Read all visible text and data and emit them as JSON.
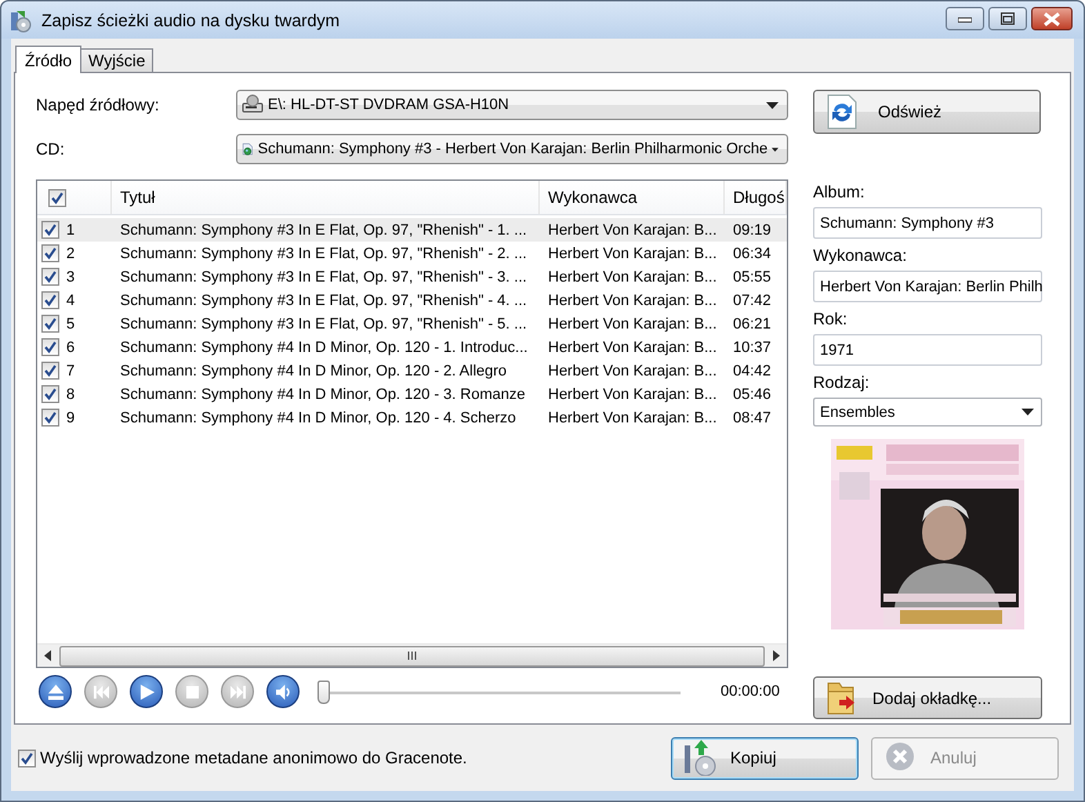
{
  "window": {
    "title": "Zapisz ścieżki audio na dysku twardym"
  },
  "tabs": [
    {
      "label": "Źródło",
      "selected": true
    },
    {
      "label": "Wyjście",
      "selected": false
    }
  ],
  "source": {
    "drive_label": "Napęd źródłowy:",
    "drive": "E\\: HL-DT-ST DVDRAM GSA-H10N",
    "cd_label": "CD:",
    "cd": "Schumann: Symphony #3 - Herbert Von Karajan: Berlin Philharmonic Orche",
    "refresh_button": "Odśwież"
  },
  "tracks": {
    "all_checked": true,
    "columns": [
      "Tytuł",
      "Wykonawca",
      "Długoś"
    ],
    "rows": [
      {
        "number": "1",
        "title": "Schumann: Symphony #3 In E Flat, Op. 97, \"Rhenish\" - 1. ...",
        "artist": "Herbert Von Karajan: B...",
        "length": "09:19",
        "checked": true,
        "selected": true
      },
      {
        "number": "2",
        "title": "Schumann: Symphony #3 In E Flat, Op. 97, \"Rhenish\" - 2. ...",
        "artist": "Herbert Von Karajan: B...",
        "length": "06:34",
        "checked": true,
        "selected": false
      },
      {
        "number": "3",
        "title": "Schumann: Symphony #3 In E Flat, Op. 97, \"Rhenish\" - 3. ...",
        "artist": "Herbert Von Karajan: B...",
        "length": "05:55",
        "checked": true,
        "selected": false
      },
      {
        "number": "4",
        "title": "Schumann: Symphony #3 In E Flat, Op. 97, \"Rhenish\" - 4. ...",
        "artist": "Herbert Von Karajan: B...",
        "length": "07:42",
        "checked": true,
        "selected": false
      },
      {
        "number": "5",
        "title": "Schumann: Symphony #3 In E Flat, Op. 97, \"Rhenish\" - 5. ...",
        "artist": "Herbert Von Karajan: B...",
        "length": "06:21",
        "checked": true,
        "selected": false
      },
      {
        "number": "6",
        "title": "Schumann: Symphony #4 In D Minor, Op. 120 - 1. Introduc...",
        "artist": "Herbert Von Karajan: B...",
        "length": "10:37",
        "checked": true,
        "selected": false
      },
      {
        "number": "7",
        "title": "Schumann: Symphony #4 In D Minor, Op. 120 - 2. Allegro",
        "artist": "Herbert Von Karajan: B...",
        "length": "04:42",
        "checked": true,
        "selected": false
      },
      {
        "number": "8",
        "title": "Schumann: Symphony #4 In D Minor, Op. 120 - 3. Romanze",
        "artist": "Herbert Von Karajan: B...",
        "length": "05:46",
        "checked": true,
        "selected": false
      },
      {
        "number": "9",
        "title": "Schumann: Symphony #4 In D Minor, Op. 120 - 4. Scherzo",
        "artist": "Herbert Von Karajan: B...",
        "length": "08:47",
        "checked": true,
        "selected": false
      }
    ]
  },
  "player": {
    "buttons": [
      {
        "kind": "eject",
        "disabled": false
      },
      {
        "kind": "previous",
        "disabled": true
      },
      {
        "kind": "play",
        "disabled": false
      },
      {
        "kind": "stop",
        "disabled": true
      },
      {
        "kind": "next",
        "disabled": true
      },
      {
        "kind": "volume",
        "disabled": false
      }
    ],
    "position": {
      "level": 0
    },
    "time": "00:00:00"
  },
  "metadata": {
    "album_label": "Album:",
    "album": "Schumann: Symphony #3",
    "artist_label": "Wykonawca:",
    "artist": "Herbert Von Karajan: Berlin Philh",
    "year_label": "Rok:",
    "year": "1971",
    "genre_label": "Rodzaj:",
    "genre": "Ensembles",
    "add_cover_button": "Dodaj okładkę..."
  },
  "gracenote": {
    "label": "Wyślij wprowadzone metadane anonimowo do Gracenote.",
    "checked": true
  },
  "buttons": [
    {
      "kind": "copy",
      "label": "Kopiuj",
      "disabled": false,
      "default": true
    },
    {
      "kind": "cancel",
      "label": "Anuluj",
      "disabled": true,
      "default": false
    }
  ]
}
